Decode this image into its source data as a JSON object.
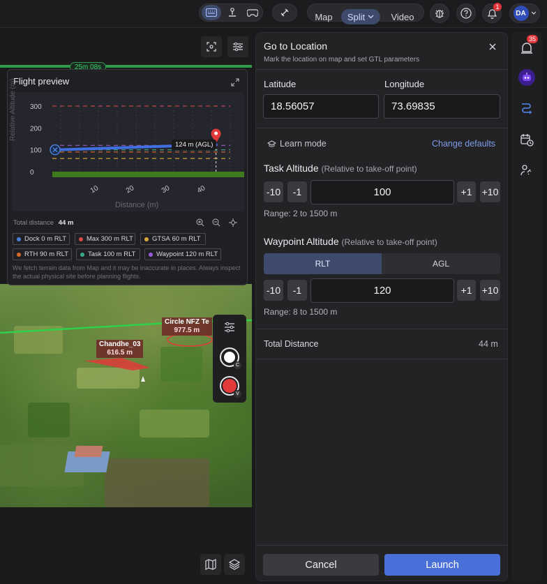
{
  "topbar": {
    "view_modes": [
      "Map",
      "Split",
      "Video"
    ],
    "active_view": "Split",
    "notification_count": "1",
    "user_initials": "DA"
  },
  "map": {
    "timer_label": "25m 08s",
    "nfz_label": "Circle NFZ Te",
    "nfz_altitude": "977.5 m",
    "poi_label": "Chandhe_03",
    "poi_altitude": "616.5 m",
    "toolbar_key_c": "C",
    "toolbar_key_v": "V"
  },
  "flight_preview": {
    "title": "Flight preview",
    "total_distance_label": "Total distance",
    "total_distance_value": "44 m",
    "marker_label": "124 m (AGL)",
    "disclaimer": "We fetch terrain data from Map and it may be inaccurate in places. Always inspect the actual physical site before planning flights.",
    "legend": [
      {
        "label": "Dock",
        "value": "0 m RLT",
        "color": "#4a7fd6"
      },
      {
        "label": "Max",
        "value": "300 m RLT",
        "color": "#d64a4a"
      },
      {
        "label": "GTSA",
        "value": "60 m RLT",
        "color": "#d6a93a"
      },
      {
        "label": "RTH",
        "value": "90 m RLT",
        "color": "#d66a2a"
      },
      {
        "label": "Task",
        "value": "100 m RLT",
        "color": "#3aa88a"
      },
      {
        "label": "Waypoint",
        "value": "120 m RLT",
        "color": "#9a5ad6"
      }
    ]
  },
  "chart_data": {
    "type": "line",
    "title": "Flight preview",
    "xlabel": "Distance (m)",
    "ylabel": "Relative Altitude (m)",
    "ylim": [
      0,
      300
    ],
    "y_ticks": [
      "300",
      "200",
      "100",
      "0"
    ],
    "x_ticks": [
      "10",
      "20",
      "30",
      "40"
    ],
    "reference_lines": [
      {
        "name": "Max",
        "y": 300,
        "color": "#d64a4a"
      },
      {
        "name": "Waypoint",
        "y": 120,
        "color": "#9a5ad6"
      },
      {
        "name": "Task",
        "y": 100,
        "color": "#3aa88a"
      },
      {
        "name": "RTH",
        "y": 90,
        "color": "#d66a2a"
      },
      {
        "name": "GTSA",
        "y": 60,
        "color": "#d6a93a"
      },
      {
        "name": "Dock",
        "y": 0,
        "color": "#4a7fd6"
      }
    ],
    "series": [
      {
        "x": [
          0,
          44
        ],
        "y": [
          100,
          124
        ],
        "color": "#3f6fe0"
      }
    ],
    "terrain": {
      "color": "#3e7a1e"
    }
  },
  "panel": {
    "title": "Go to Location",
    "subtitle": "Mark the location on map and set GTL parameters",
    "latitude_label": "Latitude",
    "latitude_value": "18.56057",
    "longitude_label": "Longitude",
    "longitude_value": "73.69835",
    "learn_mode": "Learn mode",
    "change_defaults": "Change defaults",
    "task_altitude_title": "Task Altitude",
    "task_altitude_hint": "(Relative to take-off point)",
    "task_altitude_value": "100",
    "task_altitude_range": "Range: 2 to 1500 m",
    "waypoint_altitude_title": "Waypoint Altitude",
    "waypoint_altitude_hint": "(Relative to take-off point)",
    "waypoint_mode_options": [
      "RLT",
      "AGL"
    ],
    "waypoint_mode_selected": "RLT",
    "waypoint_altitude_value": "120",
    "waypoint_altitude_range": "Range: 8 to 1500 m",
    "step_labels": [
      "-10",
      "-1",
      "+1",
      "+10"
    ],
    "total_distance_label": "Total Distance",
    "total_distance_value": "44 m",
    "cancel_label": "Cancel",
    "launch_label": "Launch"
  },
  "rail": {
    "alert_count": "35"
  },
  "colors": {
    "accent": "#4a6fd8",
    "link": "#7e9ce8",
    "panel_bg": "#232326"
  }
}
